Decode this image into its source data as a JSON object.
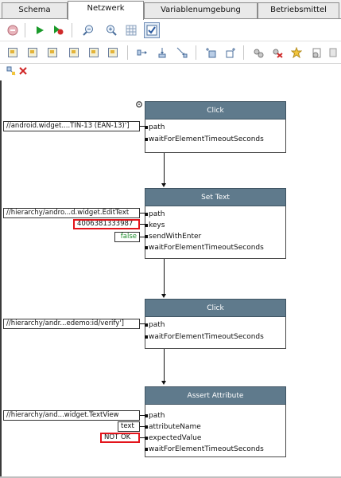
{
  "tabs": [
    {
      "label": "Schema",
      "active": false
    },
    {
      "label": "Netzwerk",
      "active": true
    },
    {
      "label": "Variablenumgebung",
      "active": false
    },
    {
      "label": "Betriebsmittel",
      "active": false
    }
  ],
  "toolbar_icons": {
    "row1": [
      "stop-icon",
      "play-icon",
      "debug-icon",
      "zoom-out-icon",
      "zoom-in-icon",
      "grid-icon",
      "check-toggle-icon"
    ],
    "row2": [
      "align-left-icon",
      "align-center-icon",
      "align-right-icon",
      "align-top-icon",
      "align-middle-icon",
      "align-bottom-icon",
      "distribute-horizontal-icon",
      "distribute-vertical-icon",
      "distribute-diagonal-icon",
      "add-node-icon",
      "add-port-icon",
      "settings-icon",
      "delete-node-icon",
      "highlight-icon",
      "hide-icon"
    ],
    "row3": [
      "link-icon",
      "close-icon"
    ]
  },
  "nodes": [
    {
      "title": "Click",
      "params": [
        "path",
        "waitForElementTimeoutSeconds"
      ],
      "inputs": [
        {
          "param": "path",
          "value": "//android.widget....TIN-13 (EAN-13)']",
          "highlight": false,
          "color": "#111111"
        }
      ]
    },
    {
      "title": "Set Text",
      "params": [
        "path",
        "keys",
        "sendWithEnter",
        "waitForElementTimeoutSeconds"
      ],
      "inputs": [
        {
          "param": "path",
          "value": "//hierarchy/andro...d.widget.EditText",
          "highlight": false,
          "color": "#111111"
        },
        {
          "param": "keys",
          "value": "4006381333987",
          "highlight": true,
          "color": "#111111"
        },
        {
          "param": "sendWithEnter",
          "value": "false",
          "highlight": false,
          "color": "#1c8a2a"
        }
      ]
    },
    {
      "title": "Click",
      "params": [
        "path",
        "waitForElementTimeoutSeconds"
      ],
      "inputs": [
        {
          "param": "path",
          "value": "//hierarchy/andr...edemo:id/verify']",
          "highlight": false,
          "color": "#111111"
        }
      ]
    },
    {
      "title": "Assert Attribute",
      "params": [
        "path",
        "attributeName",
        "expectedValue",
        "waitForElementTimeoutSeconds"
      ],
      "inputs": [
        {
          "param": "path",
          "value": "//hierarchy/and...widget.TextView",
          "highlight": false,
          "color": "#111111"
        },
        {
          "param": "attributeName",
          "value": "text",
          "highlight": false,
          "color": "#111111"
        },
        {
          "param": "expectedValue",
          "value": "NOT OK",
          "highlight": true,
          "color": "#111111"
        }
      ]
    }
  ]
}
